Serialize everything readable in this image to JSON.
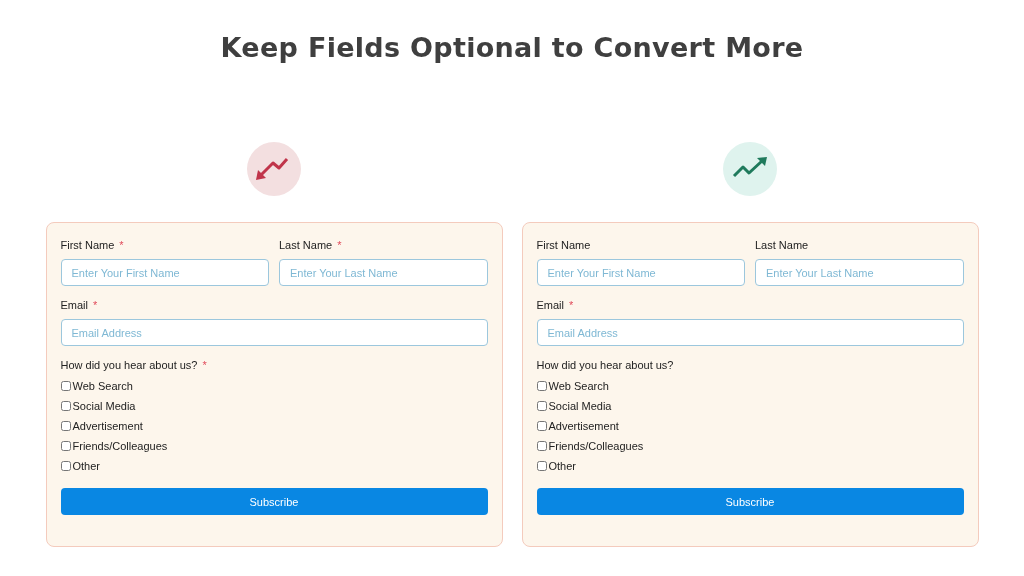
{
  "title": "Keep Fields Optional to Convert More",
  "panels": [
    {
      "kind": "down",
      "first_name": {
        "label": "First Name",
        "mark": "*",
        "placeholder": "Enter Your First Name"
      },
      "last_name": {
        "label": "Last Name",
        "mark": "*",
        "placeholder": "Enter Your Last Name"
      },
      "email": {
        "label": "Email",
        "mark": "*",
        "placeholder": "Email Address"
      },
      "question": {
        "label": "How did you hear about us?",
        "mark": "*"
      },
      "options": [
        {
          "label": "Web Search",
          "checked": false
        },
        {
          "label": "Social Media",
          "checked": false
        },
        {
          "label": "Advertisement",
          "checked": false
        },
        {
          "label": "Friends/Colleagues",
          "checked": false
        },
        {
          "label": "Other",
          "checked": false
        }
      ],
      "button": "Subscribe"
    },
    {
      "kind": "up",
      "first_name": {
        "label": "First Name",
        "placeholder": "Enter Your First Name"
      },
      "last_name": {
        "label": "Last Name",
        "placeholder": "Enter Your Last Name"
      },
      "email": {
        "label": "Email",
        "mark": "*",
        "placeholder": "Email Address"
      },
      "question": {
        "label": "How did you hear about us?"
      },
      "options": [
        {
          "label": "Web Search",
          "checked": false
        },
        {
          "label": "Social Media",
          "checked": false
        },
        {
          "label": "Advertisement",
          "checked": false
        },
        {
          "label": "Friends/Colleagues",
          "checked": false
        },
        {
          "label": "Other",
          "checked": false
        }
      ],
      "button": "Subscribe"
    }
  ]
}
